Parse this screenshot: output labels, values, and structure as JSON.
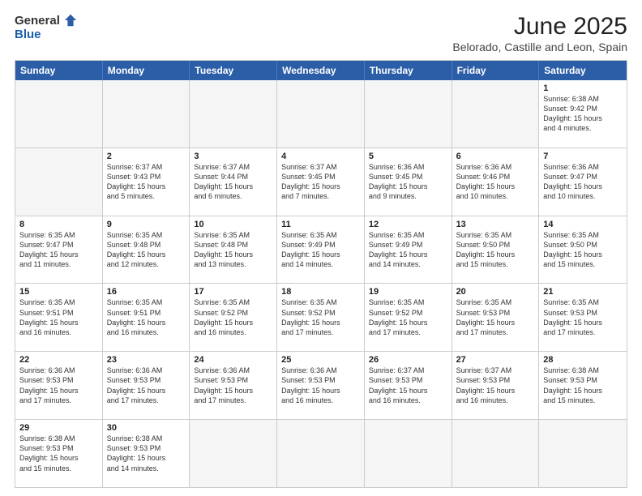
{
  "logo": {
    "general": "General",
    "blue": "Blue"
  },
  "title": "June 2025",
  "location": "Belorado, Castille and Leon, Spain",
  "header_days": [
    "Sunday",
    "Monday",
    "Tuesday",
    "Wednesday",
    "Thursday",
    "Friday",
    "Saturday"
  ],
  "rows": [
    [
      {
        "day": "",
        "empty": true
      },
      {
        "day": "",
        "empty": true
      },
      {
        "day": "",
        "empty": true
      },
      {
        "day": "",
        "empty": true
      },
      {
        "day": "",
        "empty": true
      },
      {
        "day": "",
        "empty": true
      },
      {
        "day": "1",
        "text": "Sunrise: 6:38 AM\nSunset: 9:42 PM\nDaylight: 15 hours\nand 4 minutes."
      }
    ],
    [
      {
        "day": "2",
        "text": "Sunrise: 6:37 AM\nSunset: 9:43 PM\nDaylight: 15 hours\nand 5 minutes."
      },
      {
        "day": "3",
        "text": "Sunrise: 6:37 AM\nSunset: 9:44 PM\nDaylight: 15 hours\nand 6 minutes."
      },
      {
        "day": "4",
        "text": "Sunrise: 6:37 AM\nSunset: 9:45 PM\nDaylight: 15 hours\nand 7 minutes."
      },
      {
        "day": "5",
        "text": "Sunrise: 6:36 AM\nSunset: 9:45 PM\nDaylight: 15 hours\nand 9 minutes."
      },
      {
        "day": "6",
        "text": "Sunrise: 6:36 AM\nSunset: 9:46 PM\nDaylight: 15 hours\nand 10 minutes."
      },
      {
        "day": "7",
        "text": "Sunrise: 6:36 AM\nSunset: 9:47 PM\nDaylight: 15 hours\nand 10 minutes."
      }
    ],
    [
      {
        "day": "8",
        "text": "Sunrise: 6:35 AM\nSunset: 9:47 PM\nDaylight: 15 hours\nand 11 minutes."
      },
      {
        "day": "9",
        "text": "Sunrise: 6:35 AM\nSunset: 9:48 PM\nDaylight: 15 hours\nand 12 minutes."
      },
      {
        "day": "10",
        "text": "Sunrise: 6:35 AM\nSunset: 9:48 PM\nDaylight: 15 hours\nand 13 minutes."
      },
      {
        "day": "11",
        "text": "Sunrise: 6:35 AM\nSunset: 9:49 PM\nDaylight: 15 hours\nand 14 minutes."
      },
      {
        "day": "12",
        "text": "Sunrise: 6:35 AM\nSunset: 9:49 PM\nDaylight: 15 hours\nand 14 minutes."
      },
      {
        "day": "13",
        "text": "Sunrise: 6:35 AM\nSunset: 9:50 PM\nDaylight: 15 hours\nand 15 minutes."
      },
      {
        "day": "14",
        "text": "Sunrise: 6:35 AM\nSunset: 9:50 PM\nDaylight: 15 hours\nand 15 minutes."
      }
    ],
    [
      {
        "day": "15",
        "text": "Sunrise: 6:35 AM\nSunset: 9:51 PM\nDaylight: 15 hours\nand 16 minutes."
      },
      {
        "day": "16",
        "text": "Sunrise: 6:35 AM\nSunset: 9:51 PM\nDaylight: 15 hours\nand 16 minutes."
      },
      {
        "day": "17",
        "text": "Sunrise: 6:35 AM\nSunset: 9:52 PM\nDaylight: 15 hours\nand 16 minutes."
      },
      {
        "day": "18",
        "text": "Sunrise: 6:35 AM\nSunset: 9:52 PM\nDaylight: 15 hours\nand 17 minutes."
      },
      {
        "day": "19",
        "text": "Sunrise: 6:35 AM\nSunset: 9:52 PM\nDaylight: 15 hours\nand 17 minutes."
      },
      {
        "day": "20",
        "text": "Sunrise: 6:35 AM\nSunset: 9:53 PM\nDaylight: 15 hours\nand 17 minutes."
      },
      {
        "day": "21",
        "text": "Sunrise: 6:35 AM\nSunset: 9:53 PM\nDaylight: 15 hours\nand 17 minutes."
      }
    ],
    [
      {
        "day": "22",
        "text": "Sunrise: 6:36 AM\nSunset: 9:53 PM\nDaylight: 15 hours\nand 17 minutes."
      },
      {
        "day": "23",
        "text": "Sunrise: 6:36 AM\nSunset: 9:53 PM\nDaylight: 15 hours\nand 17 minutes."
      },
      {
        "day": "24",
        "text": "Sunrise: 6:36 AM\nSunset: 9:53 PM\nDaylight: 15 hours\nand 17 minutes."
      },
      {
        "day": "25",
        "text": "Sunrise: 6:36 AM\nSunset: 9:53 PM\nDaylight: 15 hours\nand 16 minutes."
      },
      {
        "day": "26",
        "text": "Sunrise: 6:37 AM\nSunset: 9:53 PM\nDaylight: 15 hours\nand 16 minutes."
      },
      {
        "day": "27",
        "text": "Sunrise: 6:37 AM\nSunset: 9:53 PM\nDaylight: 15 hours\nand 16 minutes."
      },
      {
        "day": "28",
        "text": "Sunrise: 6:38 AM\nSunset: 9:53 PM\nDaylight: 15 hours\nand 15 minutes."
      }
    ],
    [
      {
        "day": "29",
        "text": "Sunrise: 6:38 AM\nSunset: 9:53 PM\nDaylight: 15 hours\nand 15 minutes."
      },
      {
        "day": "30",
        "text": "Sunrise: 6:38 AM\nSunset: 9:53 PM\nDaylight: 15 hours\nand 14 minutes."
      },
      {
        "day": "",
        "empty": true
      },
      {
        "day": "",
        "empty": true
      },
      {
        "day": "",
        "empty": true
      },
      {
        "day": "",
        "empty": true
      },
      {
        "day": "",
        "empty": true
      }
    ]
  ]
}
